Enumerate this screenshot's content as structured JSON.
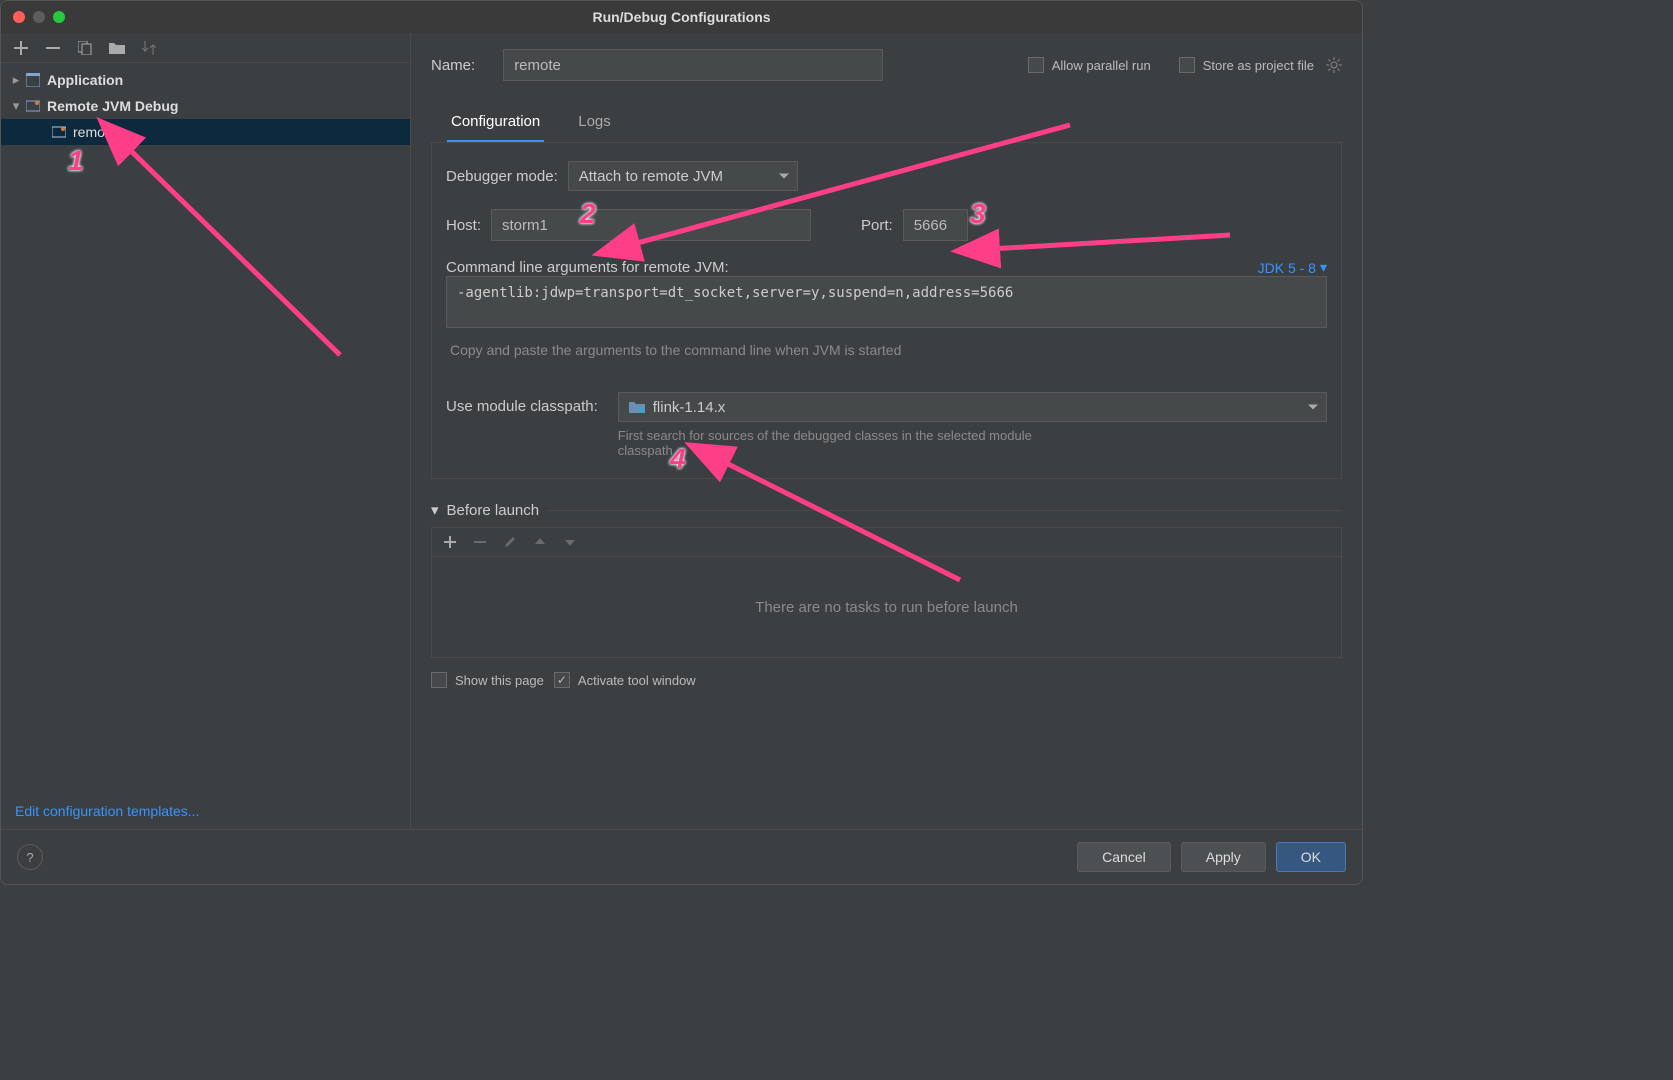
{
  "window": {
    "title": "Run/Debug Configurations"
  },
  "sidebar": {
    "items": [
      {
        "label": "Application",
        "expanded": false
      },
      {
        "label": "Remote JVM Debug",
        "expanded": true
      },
      {
        "label": "remote",
        "selected": true
      }
    ],
    "edit_templates": "Edit configuration templates..."
  },
  "form": {
    "name_label": "Name:",
    "name_value": "remote",
    "allow_parallel_label": "Allow parallel run",
    "allow_parallel_checked": false,
    "store_as_project_label": "Store as project file",
    "store_as_project_checked": false
  },
  "tabs": [
    {
      "label": "Configuration",
      "active": true
    },
    {
      "label": "Logs",
      "active": false
    }
  ],
  "config": {
    "debugger_mode_label": "Debugger mode:",
    "debugger_mode_value": "Attach to remote JVM",
    "host_label": "Host:",
    "host_value": "storm1",
    "port_label": "Port:",
    "port_value": "5666",
    "cmd_label": "Command line arguments for remote JVM:",
    "jdk_label": "JDK 5 - 8",
    "cmd_value": "-agentlib:jdwp=transport=dt_socket,server=y,suspend=n,address=5666",
    "cmd_hint": "Copy and paste the arguments to the command line when JVM is started",
    "module_label": "Use module classpath:",
    "module_value": "flink-1.14.x",
    "module_hint": "First search for sources of the debugged classes in the selected module classpath"
  },
  "before_launch": {
    "header": "Before launch",
    "empty_text": "There are no tasks to run before launch"
  },
  "bottom": {
    "show_page_label": "Show this page",
    "show_page_checked": false,
    "activate_tw_label": "Activate tool window",
    "activate_tw_checked": true
  },
  "buttons": {
    "cancel": "Cancel",
    "apply": "Apply",
    "ok": "OK"
  },
  "annotations": {
    "n1": "1",
    "n2": "2",
    "n3": "3",
    "n4": "4"
  }
}
